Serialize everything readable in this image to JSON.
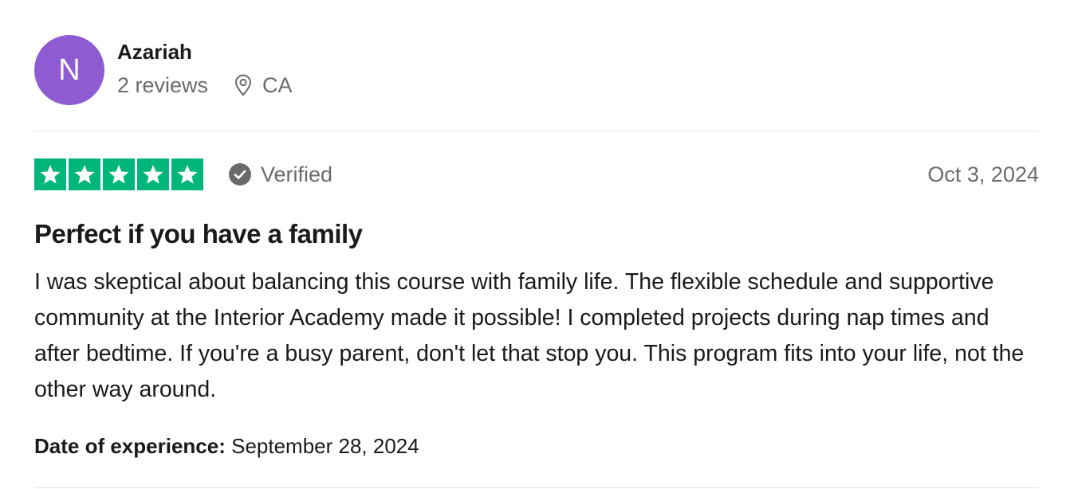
{
  "consumer": {
    "avatar_initial": "N",
    "avatar_color": "#8e5bd3",
    "name": "Azariah",
    "reviews_count": "2 reviews",
    "location_icon": "location-pin-icon",
    "location": "CA"
  },
  "rating": {
    "stars": 5,
    "star_color": "#00b67a",
    "verified_icon": "check-circle-icon",
    "verified_label": "Verified",
    "date": "Oct 3, 2024"
  },
  "review": {
    "title": "Perfect if you have a family",
    "body": "I was skeptical about balancing this course with family life. The flexible schedule and supportive community at the Interior Academy made it possible! I completed projects during nap times and after bedtime. If you're a busy parent, don't let that stop you. This program fits into your life, not the other way around.",
    "experience_label": "Date of experience:",
    "experience_date": "September 28, 2024"
  }
}
